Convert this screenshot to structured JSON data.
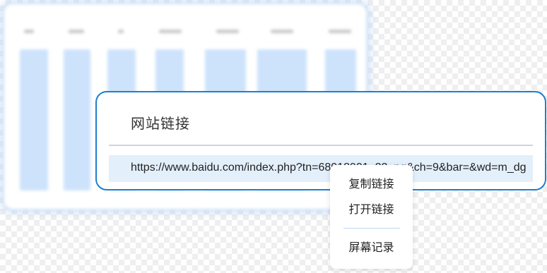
{
  "background_window": {
    "column_count": 7
  },
  "link_panel": {
    "title": "网站链接",
    "url": "https://www.baidu.com/index.php?tn=68018901_22_pg&ch=9&bar=&wd=m_dg"
  },
  "context_menu": {
    "items": [
      "复制链接",
      "打开链接",
      "屏幕记录"
    ]
  },
  "colors": {
    "panel_border": "#1d7fd0",
    "url_row_bg": "#e3effb",
    "bg_bar": "#cde3fb",
    "menu_separator": "#bcd7f3"
  }
}
